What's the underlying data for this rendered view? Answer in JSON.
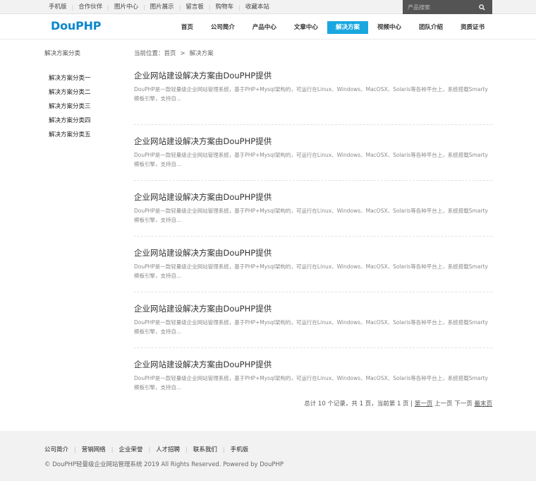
{
  "topbar": {
    "links": [
      "手机版",
      "合作伙伴",
      "图片中心",
      "图片展示",
      "留言板",
      "购物车",
      "收藏本站"
    ],
    "search_placeholder": "产品搜索",
    "search_icon": "search-icon"
  },
  "header": {
    "logo_text": "DouPHP",
    "nav": [
      "首页",
      "公司简介",
      "产品中心",
      "文章中心",
      "解决方案",
      "视频中心",
      "团队介绍",
      "资质证书"
    ],
    "active_nav": "解决方案"
  },
  "sidebar": {
    "title": "解决方案分类",
    "items": [
      "解决方案分类一",
      "解决方案分类二",
      "解决方案分类三",
      "解决方案分类四",
      "解决方案分类五"
    ]
  },
  "breadcrumb": {
    "prefix": "当前位置：",
    "home": "首页",
    "separator": ">",
    "current": "解决方案"
  },
  "articles": [
    {
      "title": "企业网站建设解决方案由DouPHP提供",
      "desc": "DouPHP是一款轻量级企业网站管理系统，基于PHP+Mysql架构的，可运行在Linux、Windows、MacOSX、Solaris等各种平台上，系统搭载Smarty模板引擎，支持自..."
    },
    {
      "title": "企业网站建设解决方案由DouPHP提供",
      "desc": "DouPHP是一款轻量级企业网站管理系统，基于PHP+Mysql架构的，可运行在Linux、Windows、MacOSX、Solaris等各种平台上，系统搭载Smarty模板引擎，支持自..."
    },
    {
      "title": "企业网站建设解决方案由DouPHP提供",
      "desc": "DouPHP是一款轻量级企业网站管理系统，基于PHP+Mysql架构的，可运行在Linux、Windows、MacOSX、Solaris等各种平台上，系统搭载Smarty模板引擎，支持自..."
    },
    {
      "title": "企业网站建设解决方案由DouPHP提供",
      "desc": "DouPHP是一款轻量级企业网站管理系统，基于PHP+Mysql架构的，可运行在Linux、Windows、MacOSX、Solaris等各种平台上，系统搭载Smarty模板引擎，支持自..."
    },
    {
      "title": "企业网站建设解决方案由DouPHP提供",
      "desc": "DouPHP是一款轻量级企业网站管理系统，基于PHP+Mysql架构的，可运行在Linux、Windows、MacOSX、Solaris等各种平台上，系统搭载Smarty模板引擎，支持自..."
    },
    {
      "title": "企业网站建设解决方案由DouPHP提供",
      "desc": "DouPHP是一款轻量级企业网站管理系统，基于PHP+Mysql架构的，可运行在Linux、Windows、MacOSX、Solaris等各种平台上，系统搭载Smarty模板引擎，支持自..."
    }
  ],
  "pager": {
    "summary": "总计 10 个记录，共 1 页，当前第 1 页 | ",
    "first": "第一页",
    "prev": "上一页",
    "next": "下一页",
    "last": "最末页"
  },
  "footer": {
    "links": [
      "公司简介",
      "营销网络",
      "企业荣誉",
      "人才招聘",
      "联系我们",
      "手机版"
    ],
    "copyright": "© DouPHP轻量级企业网站管理系统 2019 All Rights Reserved. Powered by DouPHP"
  },
  "colors": {
    "brand": "#0a86cf",
    "nav_active": "#19a7e0",
    "search_bg": "#545454",
    "footer_bg": "#f2f2f2"
  }
}
